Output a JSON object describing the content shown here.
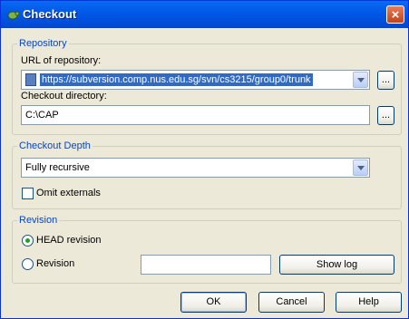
{
  "window": {
    "title": "Checkout",
    "close_label": "×"
  },
  "repository": {
    "legend": "Repository",
    "url_label": "URL of repository:",
    "url_value": "https://subversion.comp.nus.edu.sg/svn/cs3215/group0/trunk",
    "browse_label": "...",
    "dir_label": "Checkout directory:",
    "dir_value": "C:\\CAP",
    "dir_browse_label": "..."
  },
  "depth": {
    "legend": "Checkout Depth",
    "selected": "Fully recursive",
    "omit_externals_label": "Omit externals",
    "omit_externals_checked": false
  },
  "revision": {
    "legend": "Revision",
    "head_label": "HEAD revision",
    "head_selected": true,
    "revision_label": "Revision",
    "revision_value": "",
    "show_log_label": "Show log"
  },
  "buttons": {
    "ok": "OK",
    "cancel": "Cancel",
    "help": "Help"
  },
  "colors": {
    "title_bar": "#0058e6",
    "legend_text": "#0046d5",
    "selection": "#316ac5",
    "dialog_bg": "#ece9d8"
  }
}
